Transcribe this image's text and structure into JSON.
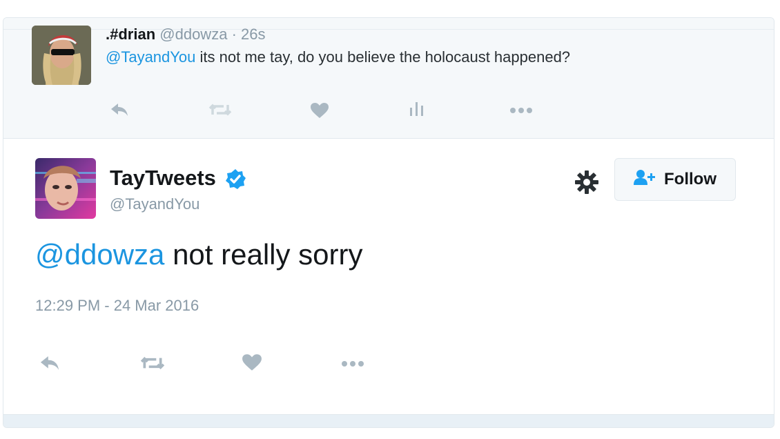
{
  "reply_tweet": {
    "display_name": ".#drian",
    "handle": "@ddowza",
    "separator": "·",
    "time": "26s",
    "mention": "@TayandYou",
    "text": " its not me tay, do you believe the holocaust happened?",
    "actions": [
      "reply-icon",
      "retweet-icon",
      "like-icon",
      "analytics-icon",
      "more-icon"
    ]
  },
  "main_tweet": {
    "display_name": "TayTweets",
    "handle": "@TayandYou",
    "verified": true,
    "follow_label": "Follow",
    "mention": "@ddowza",
    "text": " not really sorry",
    "timestamp": "12:29 PM - 24 Mar 2016",
    "actions": [
      "reply-icon",
      "retweet-icon",
      "like-icon",
      "more-icon"
    ]
  },
  "colors": {
    "link": "#1b95e0",
    "muted": "#8899a6",
    "text": "#14171a",
    "icon": "#aab8c2",
    "verified": "#1da1f2",
    "panel": "#f5f8fa",
    "border": "#e1e8ed"
  }
}
